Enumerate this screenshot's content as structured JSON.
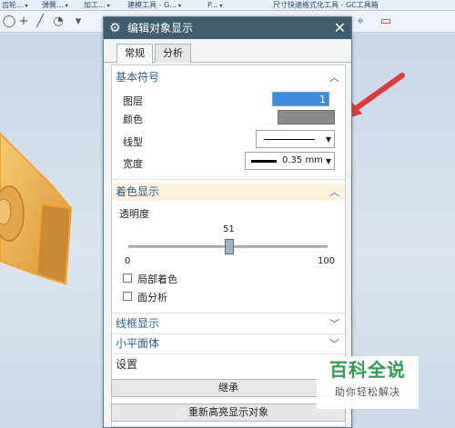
{
  "menubar": {
    "items": [
      "齿轮...",
      "弹簧...",
      "加工...",
      "建模工具 - G...",
      "P...",
      "尺寸快速格式化工具 - GC工具箱"
    ]
  },
  "dialog": {
    "title": "编辑对象显示",
    "tabs": [
      {
        "label": "常规",
        "active": true
      },
      {
        "label": "分析",
        "active": false
      }
    ],
    "basic_symbol": {
      "header": "基本符号",
      "layer_label": "图层",
      "layer_value": "1",
      "color_label": "颜色",
      "color_value": "#8b8b8b",
      "linetype_label": "线型",
      "width_label": "宽度",
      "width_value": "0.35 mm"
    },
    "shading": {
      "header": "着色显示",
      "transparency_label": "透明度",
      "transparency_value": "51",
      "slider_min": "0",
      "slider_max": "100",
      "partial_shading_label": "局部着色",
      "face_analysis_label": "面分析"
    },
    "collapsed_sections": {
      "wireframe": "线框显示",
      "facet": "小平面体",
      "settings": "设置"
    },
    "buttons": {
      "inherit": "继承",
      "rehighlight": "重新高亮显示对象"
    }
  },
  "watermark": {
    "title": "百科全说",
    "subtitle": "助你轻松解决"
  },
  "colors": {
    "title_bar": "#3f5f6f",
    "section_header_text": "#2d5f93",
    "selected_input": "#3b8cde",
    "part_body": "#f2b64a",
    "arrow": "#e03a3a",
    "watermark_green": "#2f9d4d"
  }
}
